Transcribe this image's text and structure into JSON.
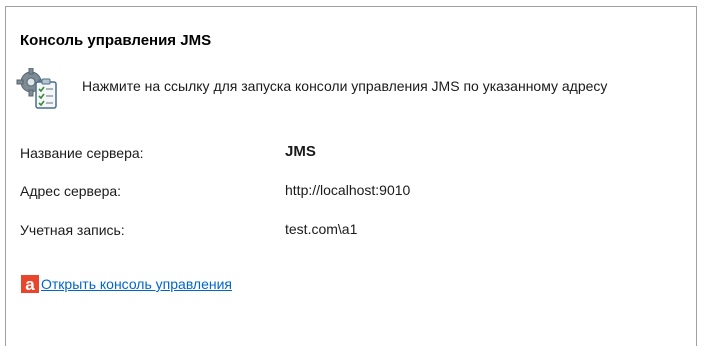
{
  "panel": {
    "title": "Консоль управления JMS",
    "info_text": "Нажмите на ссылку для запуска консоли управления JMS по указанному адресу",
    "info_icon": "gear-clipboard-icon"
  },
  "fields": [
    {
      "label": "Название сервера:",
      "value": "JMS"
    },
    {
      "label": "Адрес сервера:",
      "value": "http://localhost:9010"
    },
    {
      "label": "Учетная запись:",
      "value": "test.com\\a1"
    }
  ],
  "link": {
    "icon": "app-logo-icon",
    "label": "Открыть консоль управления",
    "accent_color": "#e8452c",
    "link_color": "#0066cc"
  }
}
